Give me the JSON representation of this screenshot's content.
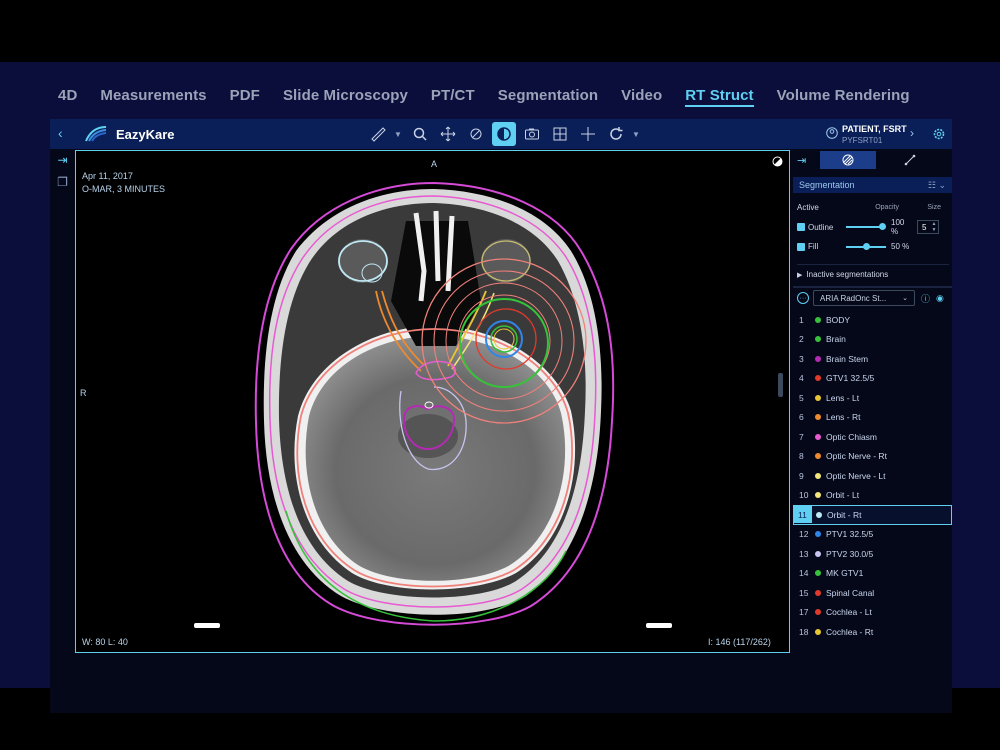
{
  "tabs": [
    "4D",
    "Measurements",
    "PDF",
    "Slide Microscopy",
    "PT/CT",
    "Segmentation",
    "Video",
    "RT Struct",
    "Volume Rendering"
  ],
  "active_tab": "RT Struct",
  "app": {
    "brand": "EazyKare"
  },
  "patient": {
    "name": "PATIENT, FSRT",
    "id": "PYFSRT01"
  },
  "viewer": {
    "date": "Apr 11, 2017",
    "series": "O-MAR, 3 MINUTES",
    "orientation_top": "A",
    "orientation_left": "R",
    "wl": "W: 80  L: 40",
    "image_index": "I: 146 (117/262)"
  },
  "panel": {
    "segmentation_label": "Segmentation",
    "active_label": "Active",
    "opacity_label": "Opacity",
    "size_label": "Size",
    "outline_label": "Outline",
    "outline_value": "100 %",
    "size_value": "5",
    "fill_label": "Fill",
    "fill_value": "50 %",
    "inactive_label": "Inactive segmentations",
    "source_select": "ARIA RadOnc St...",
    "outline_level": 1.0,
    "fill_level": 0.5
  },
  "structures": [
    {
      "n": "1",
      "name": "BODY",
      "color": "#36c23a"
    },
    {
      "n": "2",
      "name": "Brain",
      "color": "#36c23a"
    },
    {
      "n": "3",
      "name": "Brain Stem",
      "color": "#b52ab5"
    },
    {
      "n": "4",
      "name": "GTV1 32.5/5",
      "color": "#e23a2a"
    },
    {
      "n": "5",
      "name": "Lens - Lt",
      "color": "#e8c633"
    },
    {
      "n": "6",
      "name": "Lens - Rt",
      "color": "#f08a2e"
    },
    {
      "n": "7",
      "name": "Optic Chiasm",
      "color": "#e85ad2"
    },
    {
      "n": "8",
      "name": "Optic Nerve - Rt",
      "color": "#f08a2e"
    },
    {
      "n": "9",
      "name": "Optic Nerve - Lt",
      "color": "#f5e67a"
    },
    {
      "n": "10",
      "name": "Orbit - Lt",
      "color": "#f5e67a"
    },
    {
      "n": "11",
      "name": "Orbit - Rt",
      "color": "#bfe8f5"
    },
    {
      "n": "12",
      "name": "PTV1 32.5/5",
      "color": "#2f86e8"
    },
    {
      "n": "13",
      "name": "PTV2 30.0/5",
      "color": "#c7c4f0"
    },
    {
      "n": "14",
      "name": "MK GTV1",
      "color": "#36c23a"
    },
    {
      "n": "15",
      "name": "Spinal Canal",
      "color": "#e23a2a"
    },
    {
      "n": "17",
      "name": "Cochlea - Lt",
      "color": "#e23a2a"
    },
    {
      "n": "18",
      "name": "Cochlea - Rt",
      "color": "#e8c633"
    }
  ],
  "active_structure": "11"
}
